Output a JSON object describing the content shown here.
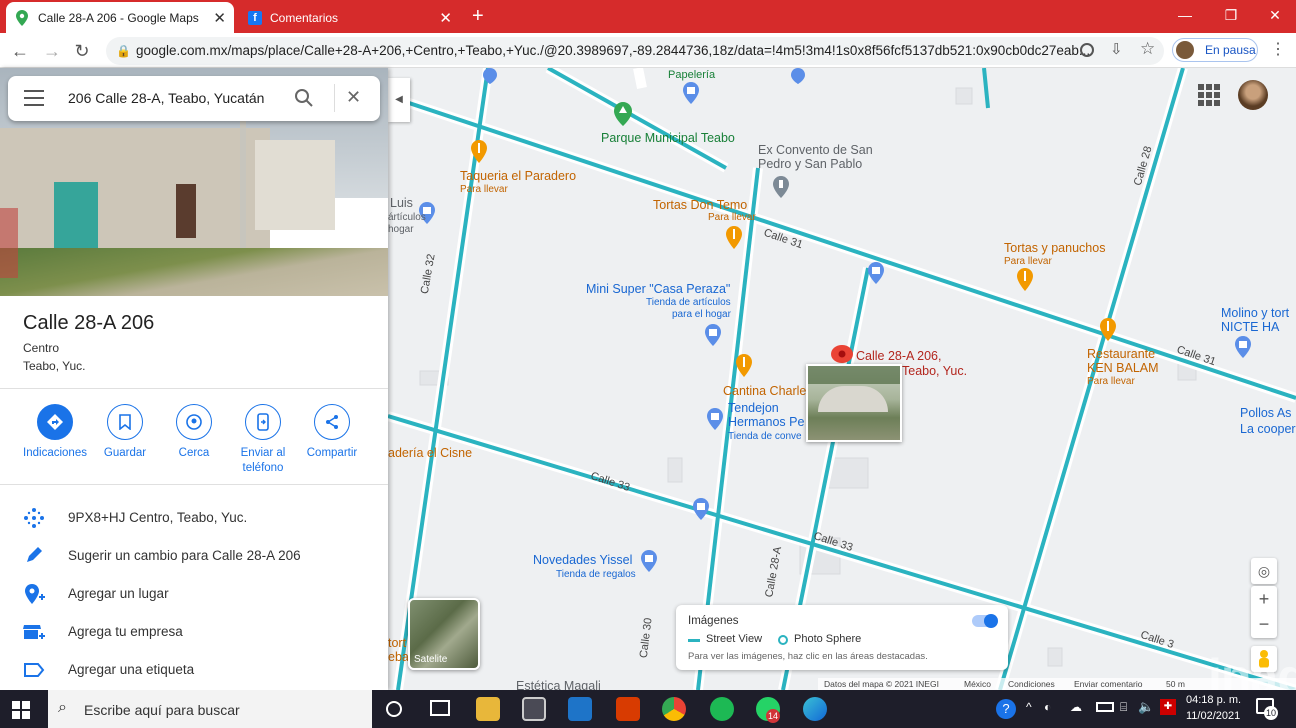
{
  "browser": {
    "tabs": [
      {
        "label": "Calle 28-A 206 - Google Maps",
        "active": true
      },
      {
        "label": "Comentarios",
        "active": false
      }
    ],
    "new_tab": "+",
    "url": "google.com.mx/maps/place/Calle+28-A+206,+Centro,+Teabo,+Yuc./@20.3989697,-89.2844736,18z/data=!4m5!3m4!1s0x8f56fcf5137db521:0x90cb0dc27eab...",
    "profile_status": "En pausa",
    "window_controls": [
      "—",
      "❐",
      "✕"
    ]
  },
  "search": {
    "value": "206 Calle 28-A, Teabo, Yucatán"
  },
  "place": {
    "title": "Calle 28-A 206",
    "line1": "Centro",
    "line2": "Teabo, Yuc."
  },
  "actions": [
    {
      "label": "Indicaciones",
      "icon": "directions-icon"
    },
    {
      "label": "Guardar",
      "icon": "bookmark-icon"
    },
    {
      "label": "Cerca",
      "icon": "nearby-icon"
    },
    {
      "label": "Enviar al teléfono",
      "icon": "send-to-phone-icon"
    },
    {
      "label": "Compartir",
      "icon": "share-icon"
    }
  ],
  "info_rows": [
    {
      "text": "9PX8+HJ Centro, Teabo, Yuc.",
      "icon": "plus-code-icon"
    },
    {
      "text": "Sugerir un cambio para Calle 28-A 206",
      "icon": "pencil-icon"
    },
    {
      "text": "Agregar un lugar",
      "icon": "add-place-icon"
    },
    {
      "text": "Agrega tu empresa",
      "icon": "add-business-icon"
    },
    {
      "text": "Agregar una etiqueta",
      "icon": "label-icon"
    }
  ],
  "map": {
    "pois": {
      "papeleria": "Papelería",
      "parque": "Parque Municipal Teabo",
      "convento1": "Ex Convento de San",
      "convento2": "Pedro y San Pablo",
      "taqueria": "Taqueria el Paradero",
      "taqueria_sub": "Para llevar",
      "tortas_don": "Tortas Don Temo",
      "tortas_don_sub": "Para llevar",
      "luis": "Luis",
      "luis_sub1": "ártículos",
      "luis_sub2": "hogar",
      "tortas_pan": "Tortas y panuchos",
      "tortas_pan_sub": "Para llevar",
      "mini1": "Mini Super \"Casa Peraza\"",
      "mini2": "Tienda de artículos",
      "mini3": "para el hogar",
      "molino1": "Molino y tort",
      "molino2": "NICTE HA",
      "rest1": "Restaurante",
      "rest2": "KEN BALAM",
      "rest_sub": "Para llevar",
      "pin1": "Calle 28-A 206,",
      "pin2": "Teabo, Yuc.",
      "cantina": "Cantina Charle",
      "tendejon1": "Tendejon",
      "tendejon2": "Hermanos Pe",
      "tendejon_sub": "Tienda de conve",
      "pollos1": "Pollos As",
      "pollos2": "La cooper",
      "cisne": "adería el Cisne",
      "novedades": "Novedades Yissel",
      "novedades_sub": "Tienda de regalos",
      "tort": "tort",
      "ebas": "ebas",
      "estetica": "Estética Magali"
    },
    "streets": {
      "c31a": "Calle 31",
      "c31b": "Calle 31",
      "c32": "Calle 32",
      "c28": "Calle 28",
      "c33a": "Calle 33",
      "c33b": "Calle 33",
      "c28a": "Calle 28-A",
      "c30": "Calle 30",
      "c35": "Calle 3"
    },
    "satellite_label": "Satelite",
    "layers": {
      "title": "Imágenes",
      "street_view": "Street View",
      "photo_sphere": "Photo Sphere",
      "hint": "Para ver las imágenes, haz clic en las áreas destacadas."
    },
    "footer": [
      "Datos del mapa © 2021 INEGI",
      "México",
      "Condiciones",
      "Enviar comentario",
      "50 m"
    ],
    "zoom_in": "+",
    "zoom_out": "−",
    "colors": {
      "street_view_line": "#2bb3c0",
      "road": "#ffffff",
      "map_bg": "#f1f3f4"
    }
  },
  "taskbar": {
    "search_placeholder": "Escribe aquí para buscar",
    "time": "04:18 p. m.",
    "date": "11/02/2021",
    "notification_count": "10",
    "whatsapp_badge": "14"
  },
  "watermark": "inad"
}
